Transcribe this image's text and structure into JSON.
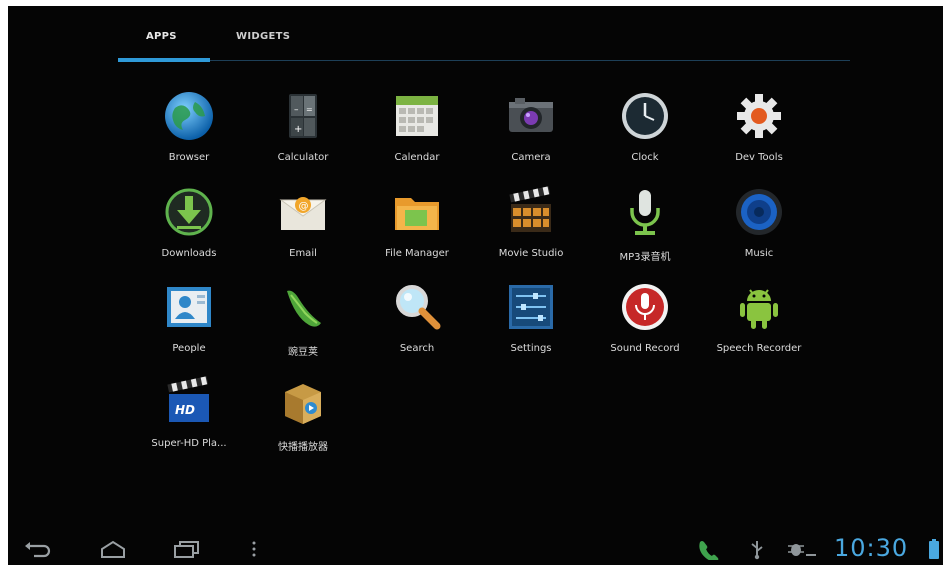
{
  "tabs": {
    "apps": "APPS",
    "widgets": "WIDGETS"
  },
  "apps": [
    {
      "label": "Browser",
      "icon": "globe-icon"
    },
    {
      "label": "Calculator",
      "icon": "calculator-icon"
    },
    {
      "label": "Calendar",
      "icon": "calendar-icon"
    },
    {
      "label": "Camera",
      "icon": "camera-icon"
    },
    {
      "label": "Clock",
      "icon": "clock-icon"
    },
    {
      "label": "Dev Tools",
      "icon": "gear-icon"
    },
    {
      "label": "Downloads",
      "icon": "download-icon"
    },
    {
      "label": "Email",
      "icon": "email-icon"
    },
    {
      "label": "File Manager",
      "icon": "folder-icon"
    },
    {
      "label": "Movie Studio",
      "icon": "clapperboard-icon"
    },
    {
      "label": "MP3录音机",
      "icon": "microphone-icon"
    },
    {
      "label": "Music",
      "icon": "speaker-icon"
    },
    {
      "label": "People",
      "icon": "contacts-icon"
    },
    {
      "label": "豌豆荚",
      "icon": "pea-pod-icon"
    },
    {
      "label": "Search",
      "icon": "magnifier-icon"
    },
    {
      "label": "Settings",
      "icon": "settings-sliders-icon"
    },
    {
      "label": "Sound Record",
      "icon": "mic-record-icon"
    },
    {
      "label": "Speech Recorder",
      "icon": "android-icon"
    },
    {
      "label": "Super-HD Pla...",
      "icon": "video-player-icon"
    },
    {
      "label": "快播播放器",
      "icon": "box-icon"
    }
  ],
  "status_bar": {
    "time": "10:30"
  }
}
